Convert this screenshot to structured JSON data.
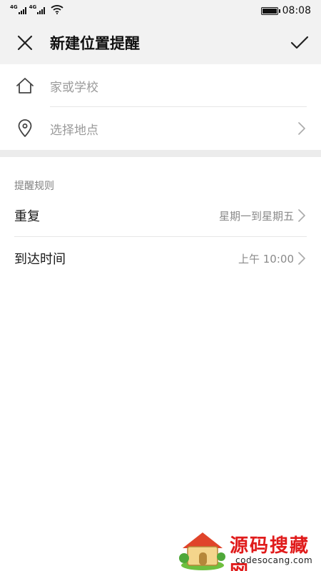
{
  "status_bar": {
    "network_1": "4G",
    "network_2": "4G",
    "time": "08:08",
    "battery_level_fraction": 1.0
  },
  "app_bar": {
    "title": "新建位置提醒"
  },
  "location": {
    "name_placeholder": "家或学校",
    "place_placeholder": "选择地点"
  },
  "rules": {
    "section_title": "提醒规则",
    "repeat": {
      "label": "重复",
      "value": "星期一到星期五"
    },
    "arrival_time": {
      "label": "到达时间",
      "value": "上午 10:00"
    }
  },
  "watermark": {
    "brand": "源码搜藏网",
    "url": "codesocang.com"
  },
  "colors": {
    "bar_bg": "#f2f2f2",
    "placeholder": "#9a9a9a",
    "watermark_red": "#e01b1b"
  },
  "icons": {
    "close": "close-icon",
    "confirm": "check-icon",
    "home": "home-icon",
    "location": "location-pin-icon",
    "chevron": "chevron-right-icon",
    "wifi": "wifi-icon",
    "battery": "battery-icon"
  }
}
